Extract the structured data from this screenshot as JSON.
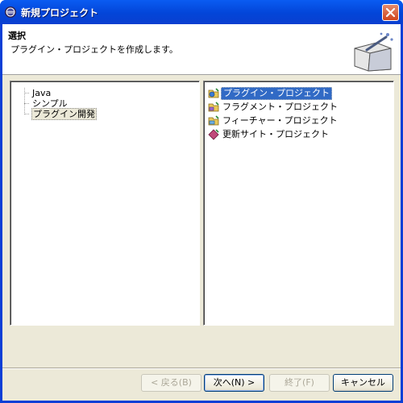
{
  "window": {
    "title": "新規プロジェクト"
  },
  "header": {
    "title": "選択",
    "description": "プラグイン・プロジェクトを作成します。"
  },
  "tree": {
    "items": [
      {
        "label": "Java",
        "selected": false
      },
      {
        "label": "シンプル",
        "selected": false
      },
      {
        "label": "プラグイン開発",
        "selected": true
      }
    ]
  },
  "list": {
    "items": [
      {
        "label": "プラグイン・プロジェクト",
        "icon": "plugin-project-icon",
        "selected": true
      },
      {
        "label": "フラグメント・プロジェクト",
        "icon": "fragment-project-icon",
        "selected": false
      },
      {
        "label": "フィーチャー・プロジェクト",
        "icon": "feature-project-icon",
        "selected": false
      },
      {
        "label": "更新サイト・プロジェクト",
        "icon": "update-site-project-icon",
        "selected": false
      }
    ]
  },
  "buttons": {
    "back": "< 戻る(B)",
    "next": "次へ(N) >",
    "finish": "終了(F)",
    "cancel": "キャンセル"
  },
  "colors": {
    "titlebar": "#0a5cf2",
    "selection": "#316ac5",
    "dialog_bg": "#ece9d8"
  }
}
